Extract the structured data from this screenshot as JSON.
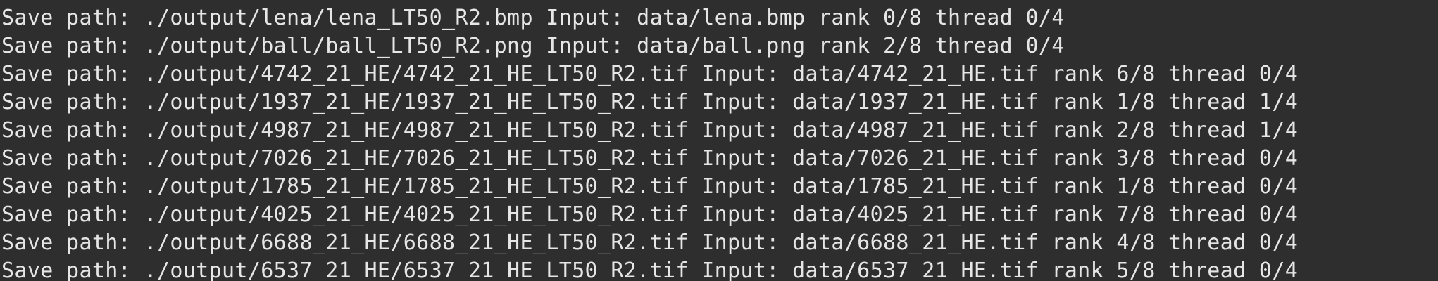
{
  "terminal": {
    "lines": [
      "Save path: ./output/lena/lena_LT50_R2.bmp Input: data/lena.bmp rank 0/8 thread 0/4",
      "Save path: ./output/ball/ball_LT50_R2.png Input: data/ball.png rank 2/8 thread 0/4",
      "Save path: ./output/4742_21_HE/4742_21_HE_LT50_R2.tif Input: data/4742_21_HE.tif rank 6/8 thread 0/4",
      "Save path: ./output/1937_21_HE/1937_21_HE_LT50_R2.tif Input: data/1937_21_HE.tif rank 1/8 thread 1/4",
      "Save path: ./output/4987_21_HE/4987_21_HE_LT50_R2.tif Input: data/4987_21_HE.tif rank 2/8 thread 1/4",
      "Save path: ./output/7026_21_HE/7026_21_HE_LT50_R2.tif Input: data/7026_21_HE.tif rank 3/8 thread 0/4",
      "Save path: ./output/1785_21_HE/1785_21_HE_LT50_R2.tif Input: data/1785_21_HE.tif rank 1/8 thread 0/4",
      "Save path: ./output/4025_21_HE/4025_21_HE_LT50_R2.tif Input: data/4025_21_HE.tif rank 7/8 thread 0/4",
      "Save path: ./output/6688_21_HE/6688_21_HE_LT50_R2.tif Input: data/6688_21_HE.tif rank 4/8 thread 0/4",
      "Save path: ./output/6537_21_HE/6537_21_HE_LT50_R2.tif Input: data/6537_21_HE.tif rank 5/8 thread 0/4"
    ]
  },
  "colors": {
    "background": "#2e2e2e",
    "foreground": "#e6e6e6"
  }
}
